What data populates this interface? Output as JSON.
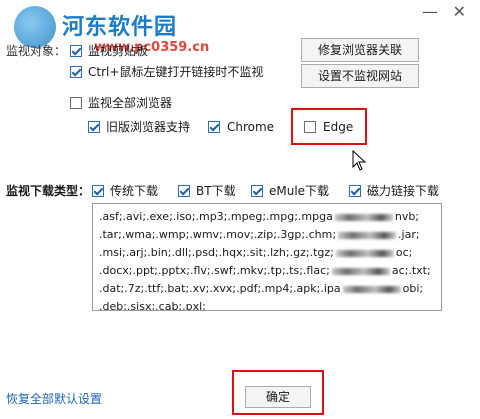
{
  "watermark": {
    "site_name": "河东软件园",
    "site_url": "www.pc0359.cn"
  },
  "window": {
    "minimize_glyph": "—",
    "close_glyph": "✕"
  },
  "monitor_section": {
    "label": "监视对象：",
    "clipboard_label": "监视剪贴板",
    "clipboard_checked": true,
    "ctrl_click_label": "Ctrl+鼠标左键打开链接时不监视",
    "ctrl_click_checked": true,
    "all_browsers_label": "监视全部浏览器",
    "all_browsers_checked": false,
    "old_browser_label": "旧版浏览器支持",
    "old_browser_checked": true,
    "chrome_label": "Chrome",
    "chrome_checked": true,
    "edge_label": "Edge",
    "edge_checked": false
  },
  "buttons": {
    "repair_association": "修复浏览器关联",
    "no_monitor_sites": "设置不监视网站",
    "ok": "确定"
  },
  "download_types": {
    "label": "监视下载类型：",
    "traditional_label": "传统下载",
    "traditional_checked": true,
    "bt_label": "BT下载",
    "bt_checked": true,
    "emule_label": "eMule下载",
    "emule_checked": true,
    "magnet_label": "磁力链接下载",
    "magnet_checked": true
  },
  "extensions": {
    "line1_a": ".asf;.avi;.exe;.iso;.mp3;.mpeg;.mpg;.mpga",
    "line1_b": "nvb;",
    "line2_a": ".tar;.wma;.wmp;.wmv;.mov;.zip;.3gp;.chm;",
    ".jar;": "",
    "line2_b": ".jar;",
    "line3_a": ".msi;.arj;.bin;.dll;.psd;.hqx;.sit;.lzh;.gz;.tgz;",
    "line3_b": "oc;",
    "line4_a": ".docx;.ppt;.pptx;.flv;.swf;.mkv;.tp;.ts;.flac;",
    "line4_b": "ac;.txt;",
    "line5_a": ".dat;.7z;.ttf;.bat;.xv;.xvx;.pdf;.mp4;.apk;.ipa",
    "line5_b": "obi;",
    "line6_a": ".deb;.sisx;.cab;.pxl;"
  },
  "footer": {
    "reset_label": "恢复全部默认设置"
  },
  "colors": {
    "highlight": "#e01010",
    "link": "#1f66b5",
    "watermark_blue": "#1a7cc9",
    "watermark_red": "#e0463c"
  }
}
